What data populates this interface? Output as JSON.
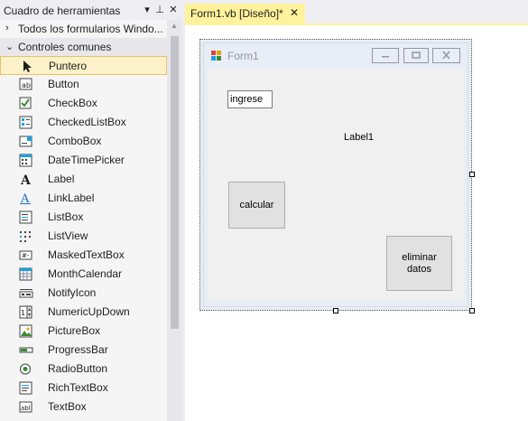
{
  "toolbox": {
    "title": "Cuadro de herramientas",
    "controls": {
      "dropdown": "▾",
      "pin": "⊥",
      "close": "✕"
    },
    "groups": [
      {
        "label": "Todos los formularios Windo...",
        "expanded": false
      },
      {
        "label": "Controles comunes",
        "expanded": true
      }
    ],
    "items": [
      {
        "label": "Puntero",
        "icon": "pointer-icon"
      },
      {
        "label": "Button",
        "icon": "button-icon"
      },
      {
        "label": "CheckBox",
        "icon": "checkbox-icon"
      },
      {
        "label": "CheckedListBox",
        "icon": "checkedlistbox-icon"
      },
      {
        "label": "ComboBox",
        "icon": "combobox-icon"
      },
      {
        "label": "DateTimePicker",
        "icon": "datetimepicker-icon"
      },
      {
        "label": "Label",
        "icon": "label-icon"
      },
      {
        "label": "LinkLabel",
        "icon": "linklabel-icon"
      },
      {
        "label": "ListBox",
        "icon": "listbox-icon"
      },
      {
        "label": "ListView",
        "icon": "listview-icon"
      },
      {
        "label": "MaskedTextBox",
        "icon": "maskedtextbox-icon"
      },
      {
        "label": "MonthCalendar",
        "icon": "monthcalendar-icon"
      },
      {
        "label": "NotifyIcon",
        "icon": "notifyicon-icon"
      },
      {
        "label": "NumericUpDown",
        "icon": "numericupdown-icon"
      },
      {
        "label": "PictureBox",
        "icon": "picturebox-icon"
      },
      {
        "label": "ProgressBar",
        "icon": "progressbar-icon"
      },
      {
        "label": "RadioButton",
        "icon": "radiobutton-icon"
      },
      {
        "label": "RichTextBox",
        "icon": "richtextbox-icon"
      },
      {
        "label": "TextBox",
        "icon": "textbox-icon"
      }
    ]
  },
  "editor": {
    "tab_label": "Form1.vb [Diseño]*",
    "tab_close": "✕"
  },
  "form": {
    "title": "Form1",
    "textbox_value": "ingrese",
    "label_text": "Label1",
    "button_calcular": "calcular",
    "button_eliminar": "eliminar datos"
  },
  "colors": {
    "accent_tab": "#fff29d",
    "selected_tool_bg": "#fcf1c8",
    "selected_tool_border": "#e5c365"
  }
}
